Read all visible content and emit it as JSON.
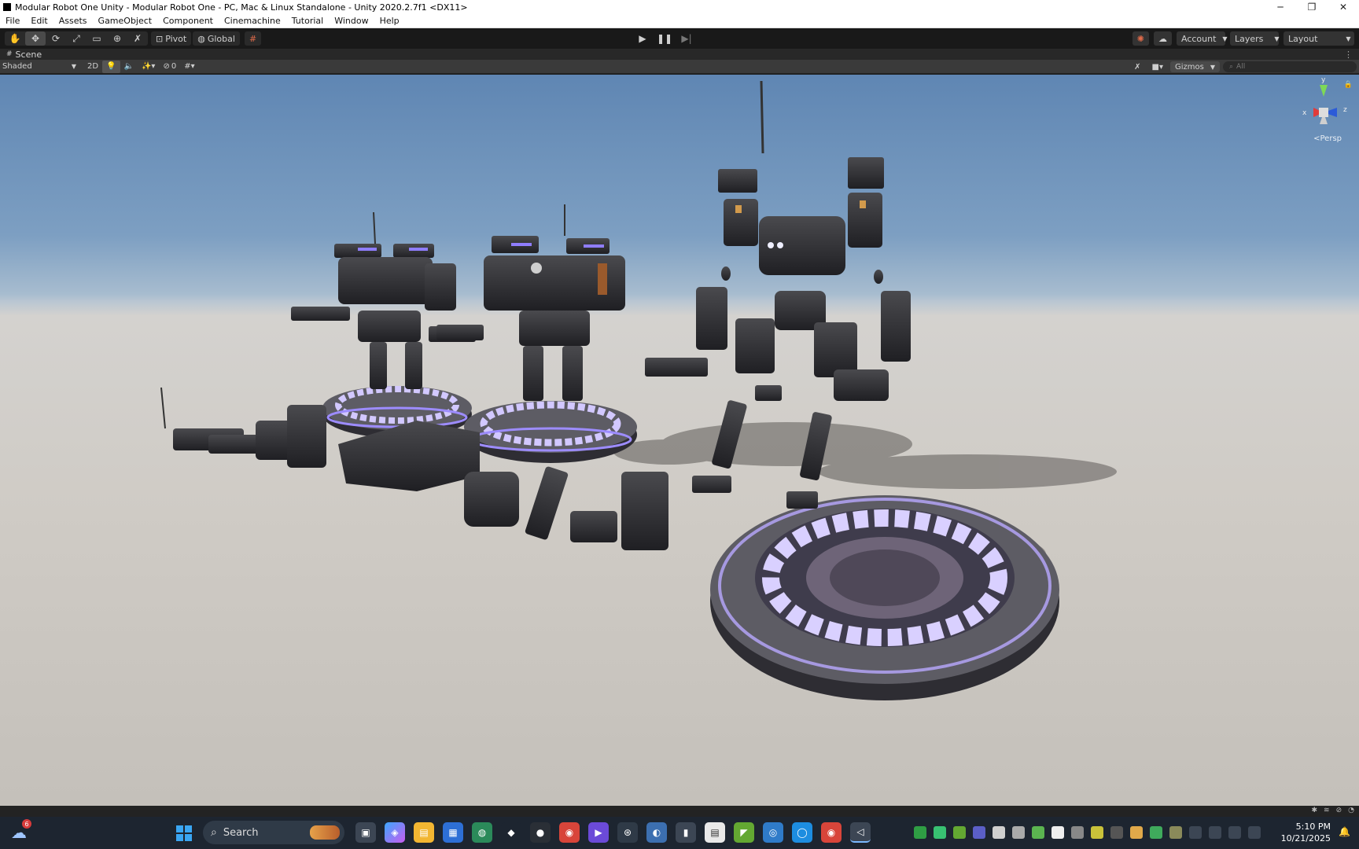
{
  "window": {
    "title": "Modular Robot One Unity - Modular Robot One - PC, Mac & Linux Standalone - Unity 2020.2.7f1 <DX11>",
    "minimize_glyph": "─",
    "restore_glyph": "❐",
    "close_glyph": "✕"
  },
  "menu": [
    "File",
    "Edit",
    "Assets",
    "GameObject",
    "Component",
    "Cinemachine",
    "Tutorial",
    "Window",
    "Help"
  ],
  "toolbar": {
    "pivot_label": "Pivot",
    "global_label": "Global",
    "account_label": "Account",
    "layers_label": "Layers",
    "layout_label": "Layout"
  },
  "scene_panel": {
    "tab_label": "Scene",
    "draw_mode": "Shaded",
    "mode_2d": "2D",
    "hidden_count": "0",
    "gizmos_label": "Gizmos",
    "search_placeholder": "All",
    "projection_label": "<Persp",
    "axis_x": "x",
    "axis_y": "y",
    "axis_z": "z"
  },
  "taskbar": {
    "search_label": "Search",
    "weather_badge": "6",
    "time": "5:10 PM",
    "date": "10/21/2025"
  },
  "colors": {
    "accent_glow": "#8f7dff",
    "unity_toolbar": "#191919",
    "taskbar_bg": "#1d2530"
  }
}
